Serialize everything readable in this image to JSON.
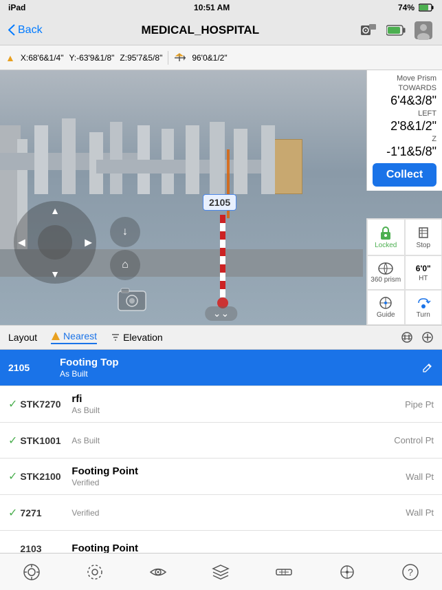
{
  "statusBar": {
    "device": "iPad",
    "time": "10:51 AM",
    "battery": "74%"
  },
  "navBar": {
    "backLabel": "Back",
    "title": "MEDICAL_HOSPITAL"
  },
  "coords": {
    "x": "X:68'6&1/4\"",
    "y": "Y:-63'9&1/8\"",
    "z": "Z:95'7&5/8\"",
    "dist": "96'0&1/2\""
  },
  "movePrism": {
    "title": "Move Prism",
    "towardsLabel": "TOWARDS",
    "towardsValue": "6'4&3/8\"",
    "leftLabel": "LEFT",
    "leftValue": "2'8&1/2\"",
    "zLabel": "Z",
    "zValue": "-1'1&5/8\"",
    "collectLabel": "Collect"
  },
  "rightPanel": {
    "lockedLabel": "Locked",
    "stopLabel": "Stop",
    "prismLabel": "360 prism",
    "htLabel": "HT",
    "htValue": "6'0\"",
    "guideLabel": "Guide",
    "turnLabel": "Turn"
  },
  "bottomToolbar": {
    "layoutLabel": "Layout",
    "nearestLabel": "Nearest",
    "elevationLabel": "Elevation"
  },
  "listRows": [
    {
      "id": "2105",
      "name": "Footing Top",
      "subtitle": "As Built",
      "type": "",
      "selected": true,
      "checked": false
    },
    {
      "id": "STK7270",
      "name": "rfi",
      "subtitle": "As Built",
      "type": "Pipe Pt",
      "selected": false,
      "checked": true
    },
    {
      "id": "STK1001",
      "name": "",
      "subtitle": "As Built",
      "type": "Control Pt",
      "selected": false,
      "checked": true
    },
    {
      "id": "STK2100",
      "name": "Footing Point",
      "subtitle": "Verified",
      "type": "Wall Pt",
      "selected": false,
      "checked": true
    },
    {
      "id": "7271",
      "name": "",
      "subtitle": "Verified",
      "type": "Wall Pt",
      "selected": false,
      "checked": true
    },
    {
      "id": "2103",
      "name": "Footing Point",
      "subtitle": "",
      "type": "",
      "selected": false,
      "checked": false
    }
  ],
  "bottomNav": {
    "buttons": [
      "target-icon",
      "settings-icon",
      "eye-icon",
      "layers-icon",
      "key-icon",
      "crosshair-icon",
      "help-icon"
    ]
  },
  "pointLabel": "2105"
}
